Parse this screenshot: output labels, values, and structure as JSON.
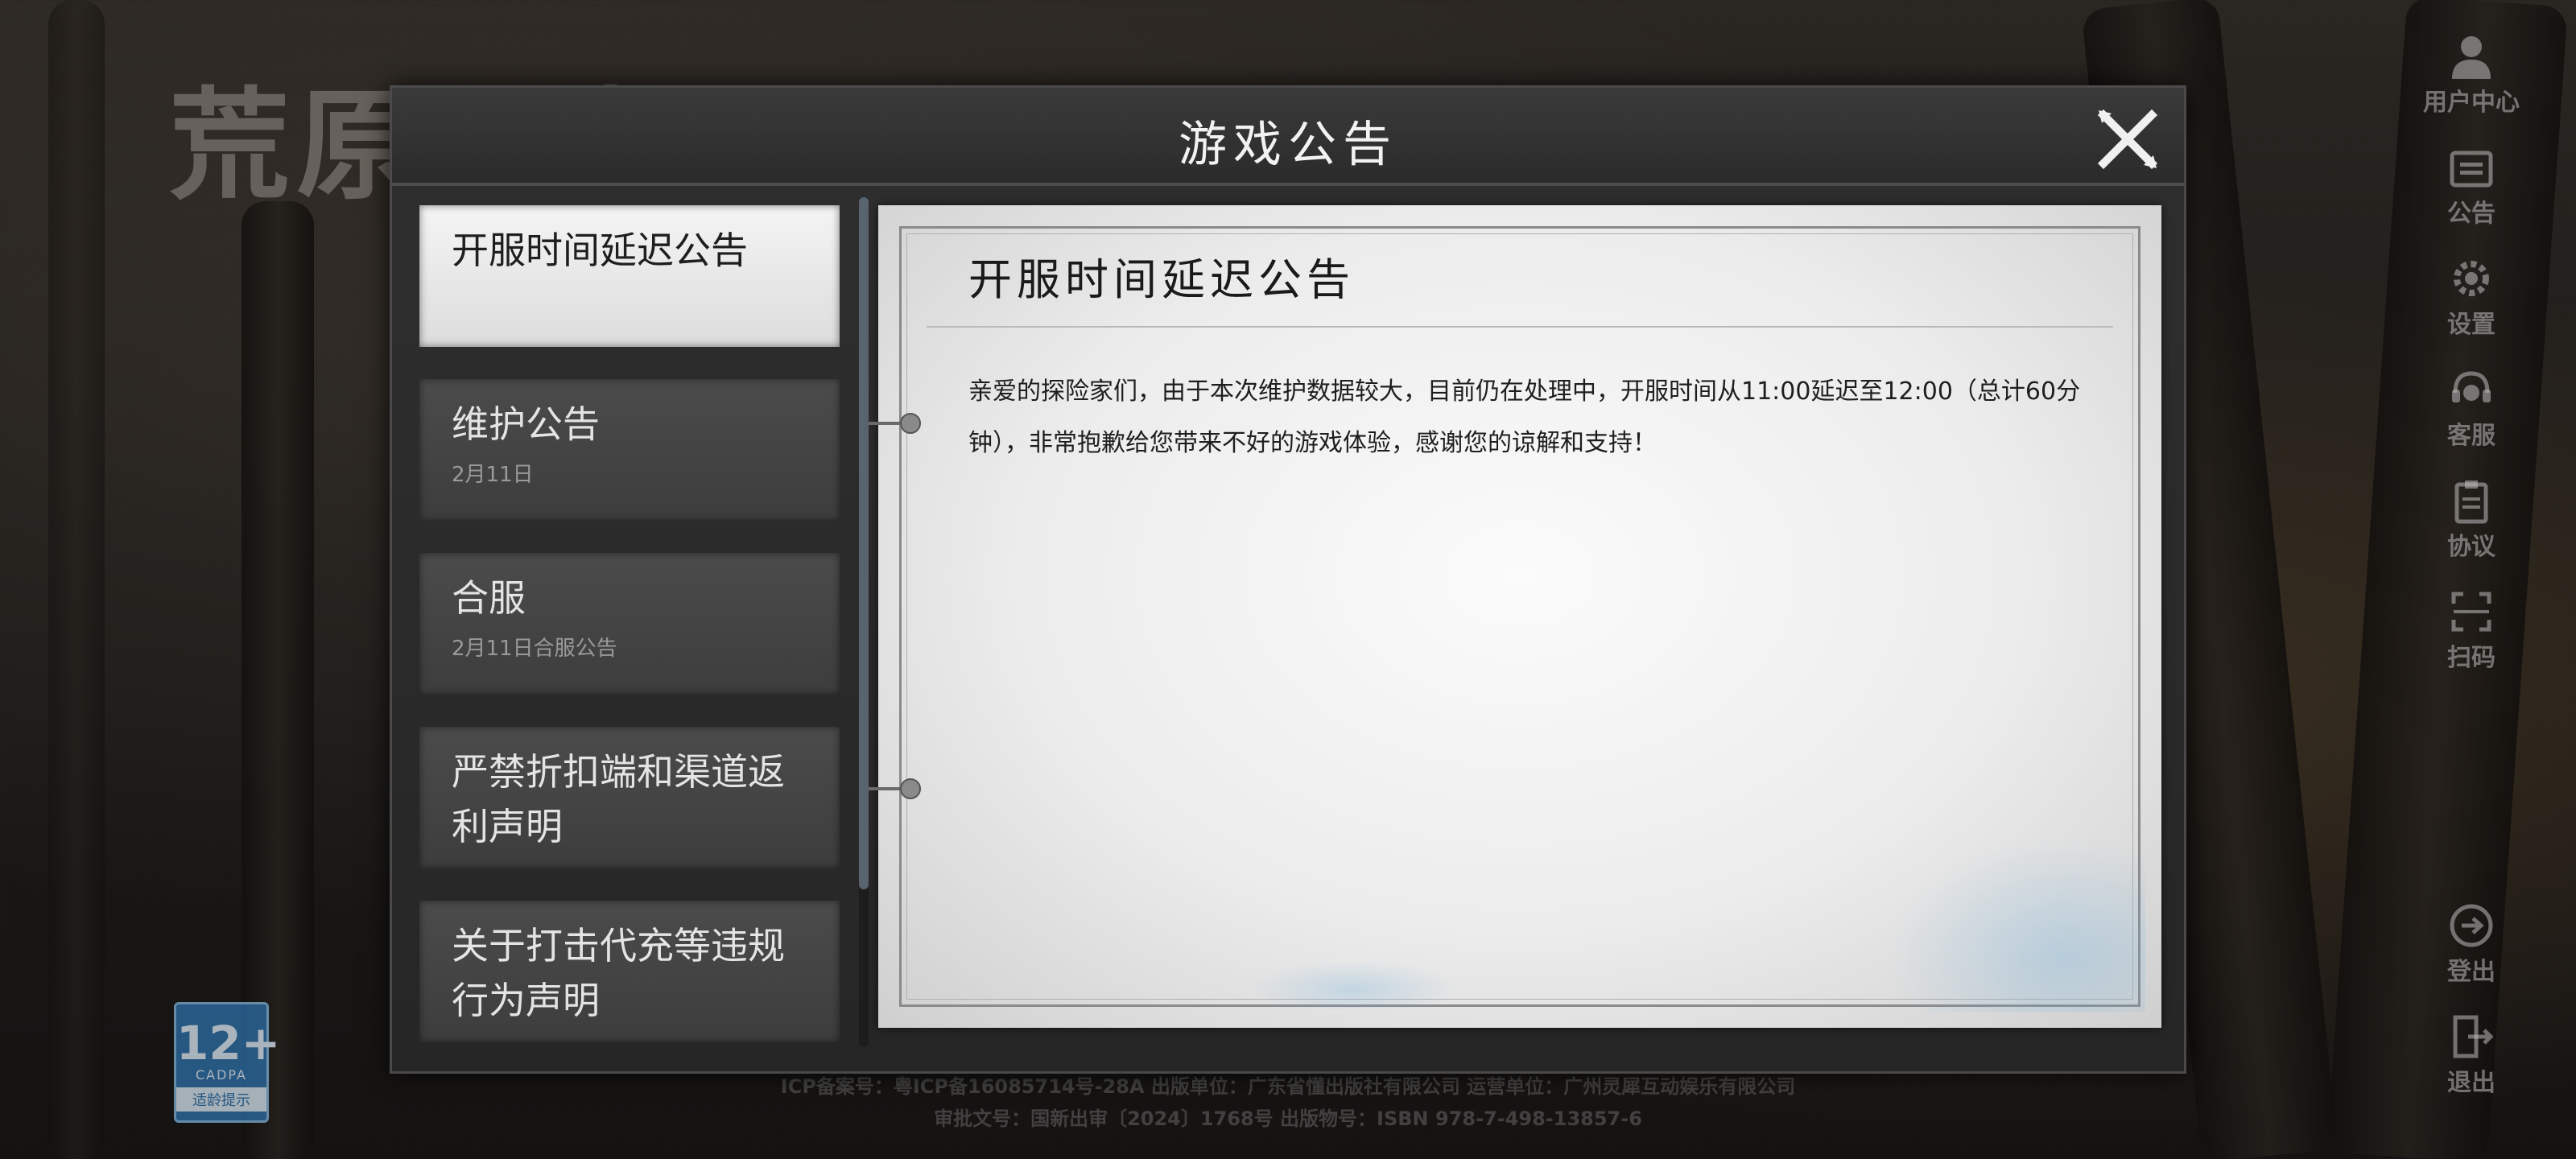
{
  "background": {
    "logo_text": "荒原曙光",
    "age_badge": {
      "age": "12+",
      "org": "CADPA",
      "hint": "适龄提示"
    },
    "footer_line1": "ICP备案号：粤ICP备16085714号-28A  出版单位：广东省懂出版社有限公司  运营单位：广州灵犀互动娱乐有限公司",
    "footer_line2": "审批文号：国新出审〔2024〕1768号  出版物号：ISBN 978-7-498-13857-6"
  },
  "side_menu": {
    "items": [
      {
        "label": "用户中心",
        "icon": "user-icon"
      },
      {
        "label": "公告",
        "icon": "announcement-icon"
      },
      {
        "label": "设置",
        "icon": "gear-icon"
      },
      {
        "label": "客服",
        "icon": "headset-icon"
      },
      {
        "label": "协议",
        "icon": "clipboard-icon"
      },
      {
        "label": "扫码",
        "icon": "scan-icon"
      }
    ],
    "bottom_items": [
      {
        "label": "登出",
        "icon": "logout-icon"
      },
      {
        "label": "退出",
        "icon": "exit-icon"
      }
    ]
  },
  "dialog": {
    "title": "游戏公告",
    "close_icon": "close-icon",
    "announcements": [
      {
        "title": "开服时间延迟公告",
        "subtitle": ""
      },
      {
        "title": "维护公告",
        "subtitle": "2月11日"
      },
      {
        "title": "合服",
        "subtitle": "2月11日合服公告"
      },
      {
        "title": "严禁折扣端和渠道返利声明",
        "subtitle": ""
      },
      {
        "title": "关于打击代充等违规行为声明",
        "subtitle": ""
      }
    ],
    "selected_index": 0,
    "content": {
      "title": "开服时间延迟公告",
      "body": "亲爱的探险家们，由于本次维护数据较大，目前仍在处理中，开服时间从11:00延迟至12:00（总计60分钟），非常抱歉给您带来不好的游戏体验，感谢您的谅解和支持！"
    }
  }
}
